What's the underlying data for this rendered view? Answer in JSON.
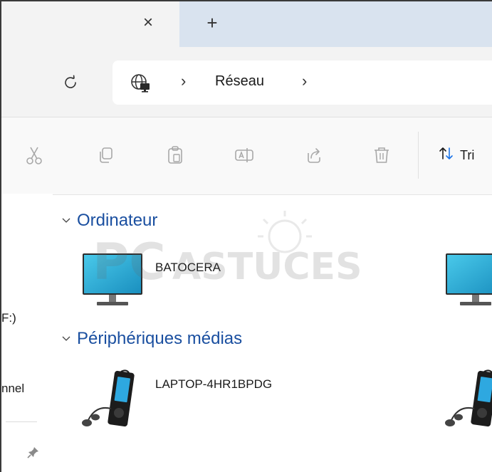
{
  "tabs": {
    "close_symbol": "×",
    "new_tab_symbol": "+"
  },
  "address": {
    "refresh_icon": "refresh-icon",
    "location_icon": "network-globe-icon",
    "separator": "›",
    "breadcrumbs": [
      "Réseau"
    ]
  },
  "toolbar": {
    "buttons": [
      "cut-icon",
      "copy-icon",
      "paste-icon",
      "rename-icon",
      "share-icon",
      "delete-icon"
    ],
    "sort_label": "Tri"
  },
  "navigation": {
    "item_1": "F:)",
    "item_2": "nnel",
    "pin_symbol": "📌"
  },
  "groups": [
    {
      "title": "Ordinateur",
      "items": [
        {
          "label": "BATOCERA",
          "icon": "computer-monitor-icon"
        },
        {
          "label": "",
          "icon": "computer-monitor-icon"
        }
      ]
    },
    {
      "title": "Périphériques médias",
      "items": [
        {
          "label": "LAPTOP-4HR1BPDG",
          "icon": "media-player-icon"
        },
        {
          "label": "",
          "icon": "media-player-icon"
        }
      ]
    }
  ],
  "watermark": {
    "text_1": "PC",
    "text_2": "ASTUCES"
  },
  "colors": {
    "tabstrip": "#d9e3ef",
    "chrome": "#f3f3f3",
    "group_title": "#1a4fa0",
    "sort_accent": "#1a73e8",
    "monitor_screen": "#2aa9d6"
  }
}
